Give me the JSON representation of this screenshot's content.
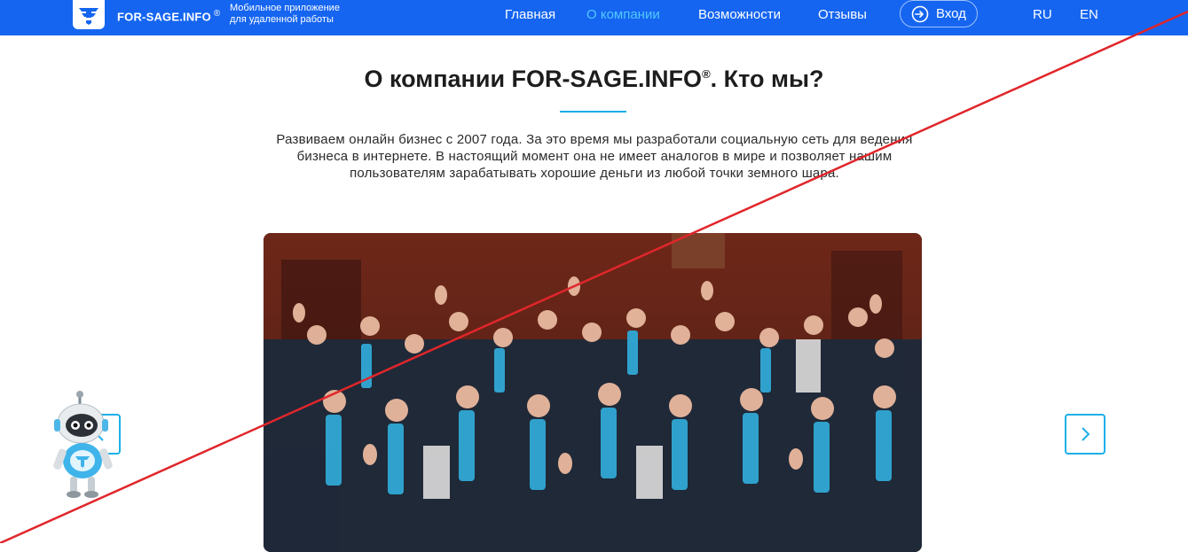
{
  "header": {
    "logo_icon": "f-logo-icon",
    "brand": "FOR-SAGE.INFO",
    "brand_mark": "®",
    "tagline_line1": "Мобильное приложение",
    "tagline_line2": "для удаленной работы",
    "nav": {
      "home": "Главная",
      "about": "О компании",
      "features": "Возможности",
      "reviews": "Отзывы"
    },
    "login_label": "Вход",
    "lang_ru": "RU",
    "lang_en": "EN"
  },
  "about": {
    "title": "О компании FOR-SAGE.INFO",
    "title_mark": "®",
    "title_suffix": ". Кто мы?",
    "intro": "Развиваем онлайн бизнес с 2007 года. За это время мы разработали социальную сеть для ведения бизнеса в интернете. В настоящий момент она не имеет аналогов в мире и позволяет нашим пользователям зарабатывать хорошие деньги из любой точки земного шара."
  },
  "carousel": {
    "prev_icon": "chevron-left-icon",
    "next_icon": "chevron-right-icon"
  },
  "colors": {
    "header_bg": "#1565f0",
    "nav_active": "#52c8ff",
    "accent": "#18aee6",
    "strike_line": "#e0262b"
  }
}
